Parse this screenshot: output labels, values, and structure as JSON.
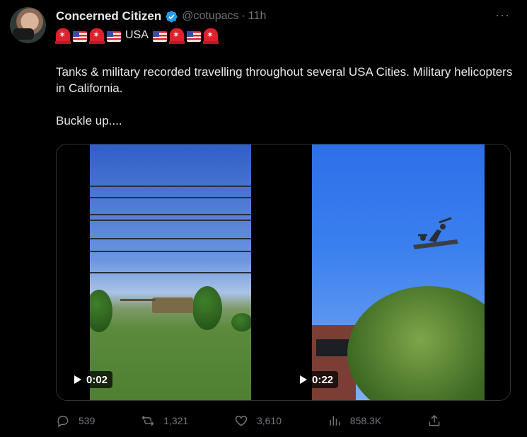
{
  "author": {
    "name": "Concerned Citizen",
    "handle": "@cotupacs",
    "separator": "·",
    "time": "11h",
    "verified": true
  },
  "flag_line": {
    "text": "USA",
    "left_emojis": [
      "siren",
      "us-flag",
      "siren",
      "us-flag"
    ],
    "right_emojis": [
      "us-flag",
      "siren",
      "us-flag",
      "siren"
    ]
  },
  "tweet": {
    "paragraph1": "Tanks & military recorded travelling throughout several USA Cities.  Military helicopters in California.",
    "paragraph2": "Buckle up...."
  },
  "media": [
    {
      "duration": "0:02"
    },
    {
      "duration": "0:22"
    }
  ],
  "actions": {
    "replies": "539",
    "reposts": "1,321",
    "likes": "3,610",
    "views": "858.3K"
  },
  "more_label": "···",
  "colors": {
    "background": "#000000",
    "text": "#e7e9ea",
    "muted": "#71767b",
    "verified": "#1d9bf0",
    "border": "#2f3336"
  }
}
